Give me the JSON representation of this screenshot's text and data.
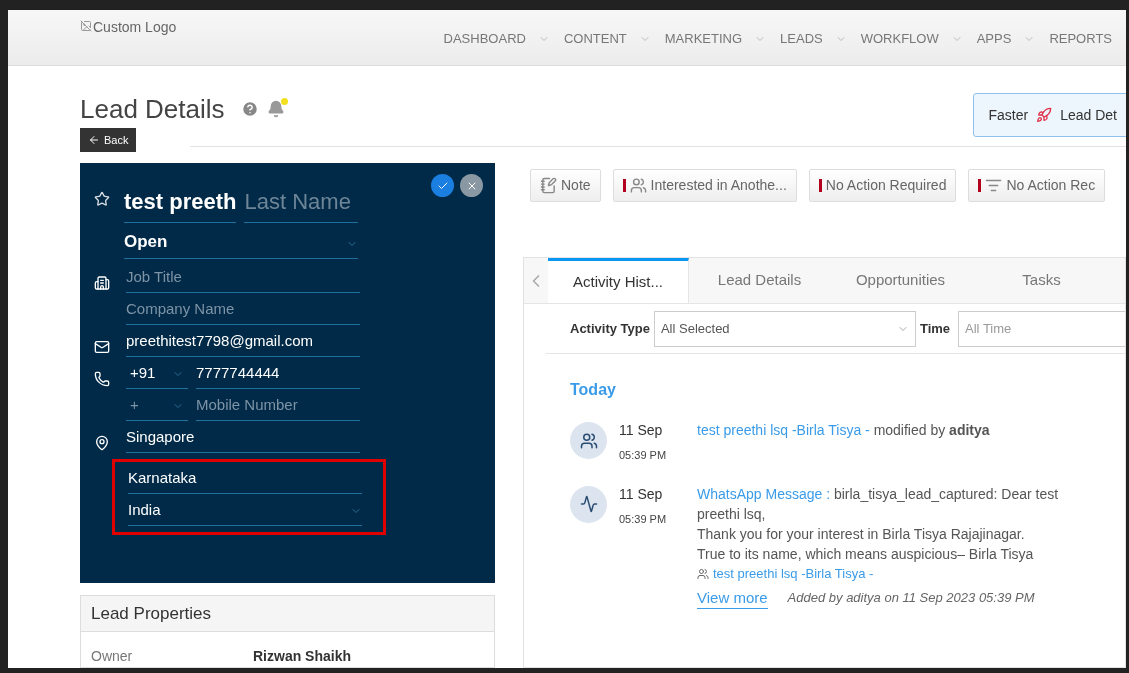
{
  "header": {
    "logo_alt": "Custom Logo",
    "nav": [
      "DASHBOARD",
      "CONTENT",
      "MARKETING",
      "LEADS",
      "WORKFLOW",
      "APPS",
      "REPORTS"
    ]
  },
  "page": {
    "title": "Lead Details",
    "back": "Back",
    "promo": [
      "Faster",
      "Lead Det"
    ]
  },
  "lead_card": {
    "first_name": "test preeth",
    "last_name_placeholder": "Last Name",
    "starred": false,
    "status": "Open",
    "fields": [
      {
        "kind": "job",
        "placeholder": "Job Title"
      },
      {
        "kind": "company",
        "placeholder": "Company Name"
      },
      {
        "kind": "email",
        "value": "preethitest7798@gmail.com"
      },
      {
        "kind": "phone",
        "code": "+91",
        "value": "7777744444"
      },
      {
        "kind": "mobile",
        "code": "+",
        "placeholder": "Mobile Number"
      },
      {
        "kind": "city",
        "value": "Singapore"
      }
    ],
    "highlighted": true,
    "address": [
      {
        "kind": "text",
        "value": "Karnataka"
      },
      {
        "kind": "select",
        "value": "India"
      }
    ]
  },
  "lead_properties": {
    "title": "Lead Properties",
    "rows": [
      {
        "label": "Owner",
        "value": "Rizwan Shaikh"
      }
    ]
  },
  "actions": [
    {
      "label": "Note",
      "kind": "note",
      "flag": false
    },
    {
      "label": "Interested in Anothe...",
      "kind": "opportunity",
      "flag": true
    },
    {
      "label": "No Action Required",
      "kind": "status",
      "flag": true
    },
    {
      "label": "No Action Rec",
      "kind": "list",
      "flag": true
    }
  ],
  "tabs": [
    {
      "label": "Activity Hist...",
      "selected": true
    },
    {
      "label": "Lead Details",
      "selected": false
    },
    {
      "label": "Opportunities",
      "selected": false
    },
    {
      "label": "Tasks",
      "selected": false
    }
  ],
  "filters": [
    {
      "label": "Activity Type",
      "value": "All Selected"
    },
    {
      "label": "Time",
      "placeholder": "All Time"
    }
  ],
  "group": "Today",
  "activities": [
    {
      "kind": "opportunity",
      "date": "11 Sep",
      "time": "05:39 PM",
      "link": "test preethi lsq -Birla Tisya -",
      "text": "modified by **aditya**"
    },
    {
      "kind": "message",
      "date": "11 Sep",
      "time": "05:39 PM",
      "link": "WhatsApp Message :",
      "text": "birla_tisya_lead_captured: Dear test preethi lsq,",
      "lines": [
        "Thank you for your interest in Birla Tisya Rajajinagar.",
        "True to its name, which means auspicious– Birla Tisya"
      ],
      "related": "test preethi lsq -Birla Tisya -",
      "more": "View more",
      "added": "Added by aditya on 11 Sep 2023 05:39 PM"
    }
  ]
}
